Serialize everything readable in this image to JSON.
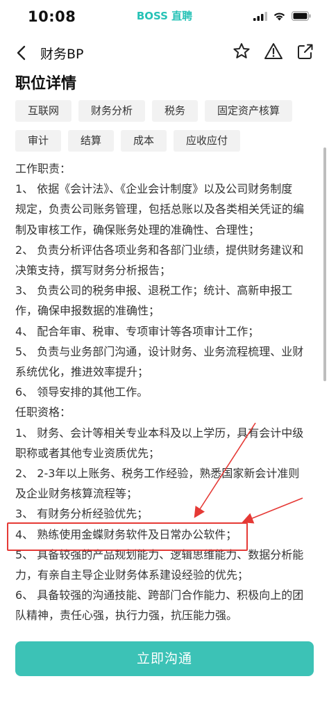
{
  "status_bar": {
    "time": "10:08",
    "app_name": "BOSS 直聘"
  },
  "nav": {
    "title": "财务BP",
    "icons": [
      "back-arrow-icon",
      "star-icon",
      "warning-icon",
      "share-icon"
    ]
  },
  "section": {
    "title": "职位详情"
  },
  "tags": [
    [
      "互联网",
      "财务分析",
      "税务",
      "固定资产核算"
    ],
    [
      "审计",
      "结算",
      "成本",
      "应收应付"
    ]
  ],
  "description": [
    "工作职责：",
    "1、 依据《会计法》、《企业会计制度》以及公司财务制度",
    "规定，负责公司账务管理，包括总账以及各类相关凭证的编",
    "制及审核工作，确保账务处理的准确性、合理性；",
    "2、 负责分析评估各项业务和各部门业绩，提供财务建议和",
    "决策支持，撰写财务分析报告；",
    "3、 负责公司的税务申报、退税工作；统计、高新申报工",
    "作，确保申报数据的准确性；",
    "4、 配合年审、税审、专项审计等各项审计工作；",
    "5、 负责与业务部门沟通，设计财务、业务流程梳理、业财",
    "系统优化，推进效率提升；",
    "6、 领导安排的其他工作。",
    "任职资格：",
    "1、 财务、会计等相关专业本科及以上学历，具有会计中级",
    "职称或者其他专业资质优先；",
    "2、 2-3年以上账务、税务工作经验，熟悉国家新会计准则",
    "及企业财务核算流程等；",
    "3、 有财务分析经验优先；",
    "4、 熟练使用金蝶财务软件及日常办公软件；",
    "5、 具备较强的产品规划能力、逻辑思维能力、数据分析能",
    "力，有亲自主导企业财务体系建设经验的优先；",
    "6、 具备较强的沟通技能、跨部门合作能力、积极向上的团",
    "队精神，责任心强，执行力强，抗压能力强。"
  ],
  "cta": {
    "label": "立即沟通"
  },
  "colors": {
    "brand": "#26c2b6",
    "cta": "#3cc2b6",
    "annotation": "#e53935"
  }
}
